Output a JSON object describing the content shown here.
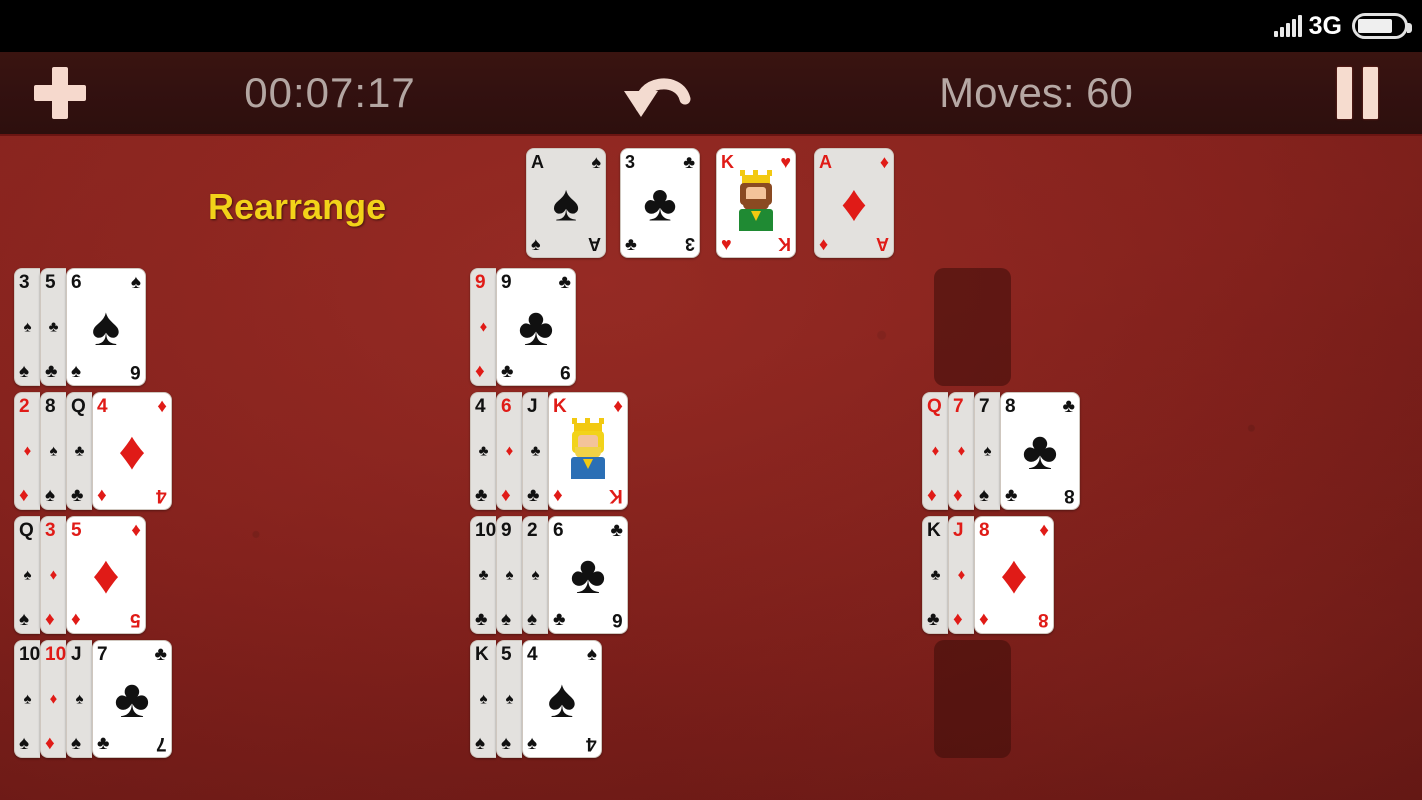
{
  "status_bar": {
    "network_label": "3G",
    "signal_icon": "signal-bars-icon",
    "battery_icon": "battery-icon"
  },
  "toolbar": {
    "new_game_icon": "plus-icon",
    "timer": "00:07:17",
    "undo_icon": "undo-arrow-icon",
    "moves": "Moves: 60",
    "pause_icon": "pause-icon"
  },
  "table": {
    "rearrange_label": "Rearrange",
    "felt_color": "#87231e",
    "empty_slot_color": "#3c0c0a",
    "highlight_color": "#ffffff",
    "red_suit_color": "#e01b17",
    "black_suit_color": "#111111"
  },
  "foundations": [
    {
      "rank": "A",
      "suit": "♠",
      "color": "black",
      "dim": true,
      "pip": "♠"
    },
    {
      "rank": "3",
      "suit": "♣",
      "color": "black",
      "dim": false,
      "pip": "♣"
    },
    {
      "rank": "K",
      "suit": "♥",
      "color": "red",
      "dim": false,
      "pip": "king-hearts-face"
    },
    {
      "rank": "A",
      "suit": "♦",
      "color": "red",
      "dim": true,
      "pip": "♦"
    }
  ],
  "tableau": {
    "columns": [
      {
        "name": "column-1",
        "piles": [
          {
            "hidden": [
              {
                "rank": "3",
                "suit": "♠",
                "color": "black"
              },
              {
                "rank": "5",
                "suit": "♣",
                "color": "black"
              }
            ],
            "top": {
              "rank": "6",
              "suit": "♠",
              "color": "black",
              "pip": "♠"
            }
          },
          {
            "hidden": [
              {
                "rank": "2",
                "suit": "♦",
                "color": "red"
              },
              {
                "rank": "8",
                "suit": "♠",
                "color": "black"
              },
              {
                "rank": "Q",
                "suit": "♣",
                "color": "black"
              }
            ],
            "top": {
              "rank": "4",
              "suit": "♦",
              "color": "red",
              "pip": "♦"
            }
          },
          {
            "hidden": [
              {
                "rank": "Q",
                "suit": "♠",
                "color": "black"
              },
              {
                "rank": "3",
                "suit": "♦",
                "color": "red"
              }
            ],
            "top": {
              "rank": "5",
              "suit": "♦",
              "color": "red",
              "pip": "♦"
            }
          },
          {
            "hidden": [
              {
                "rank": "10",
                "suit": "♠",
                "color": "black"
              },
              {
                "rank": "10",
                "suit": "♦",
                "color": "red"
              },
              {
                "rank": "J",
                "suit": "♠",
                "color": "black"
              }
            ],
            "top": {
              "rank": "7",
              "suit": "♣",
              "color": "black",
              "pip": "♣"
            }
          }
        ]
      },
      {
        "name": "column-2",
        "piles": [
          {
            "hidden": [
              {
                "rank": "9",
                "suit": "♦",
                "color": "red"
              }
            ],
            "top": {
              "rank": "9",
              "suit": "♣",
              "color": "black",
              "pip": "♣"
            }
          },
          {
            "hidden": [
              {
                "rank": "4",
                "suit": "♣",
                "color": "black"
              },
              {
                "rank": "6",
                "suit": "♦",
                "color": "red"
              },
              {
                "rank": "J",
                "suit": "♣",
                "color": "black"
              }
            ],
            "top": {
              "rank": "K",
              "suit": "♦",
              "color": "red",
              "pip": "king-diamonds-face"
            }
          },
          {
            "hidden": [
              {
                "rank": "10",
                "suit": "♣",
                "color": "black"
              },
              {
                "rank": "9",
                "suit": "♠",
                "color": "black"
              },
              {
                "rank": "2",
                "suit": "♠",
                "color": "black"
              }
            ],
            "top": {
              "rank": "6",
              "suit": "♣",
              "color": "black",
              "pip": "♣"
            }
          },
          {
            "hidden": [
              {
                "rank": "K",
                "suit": "♠",
                "color": "black"
              },
              {
                "rank": "5",
                "suit": "♠",
                "color": "black"
              }
            ],
            "top": {
              "rank": "4",
              "suit": "♠",
              "color": "black",
              "pip": "♠"
            }
          }
        ]
      },
      {
        "name": "column-3",
        "piles": [
          {
            "empty": true
          },
          {
            "hidden": [
              {
                "rank": "Q",
                "suit": "♦",
                "color": "red"
              },
              {
                "rank": "7",
                "suit": "♦",
                "color": "red"
              },
              {
                "rank": "7",
                "suit": "♠",
                "color": "black"
              }
            ],
            "top": {
              "rank": "8",
              "suit": "♣",
              "color": "black",
              "pip": "♣"
            }
          },
          {
            "hidden": [
              {
                "rank": "K",
                "suit": "♣",
                "color": "black"
              },
              {
                "rank": "J",
                "suit": "♦",
                "color": "red"
              }
            ],
            "top": {
              "rank": "8",
              "suit": "♦",
              "color": "red",
              "pip": "♦"
            }
          },
          {
            "empty": true
          }
        ]
      }
    ]
  }
}
